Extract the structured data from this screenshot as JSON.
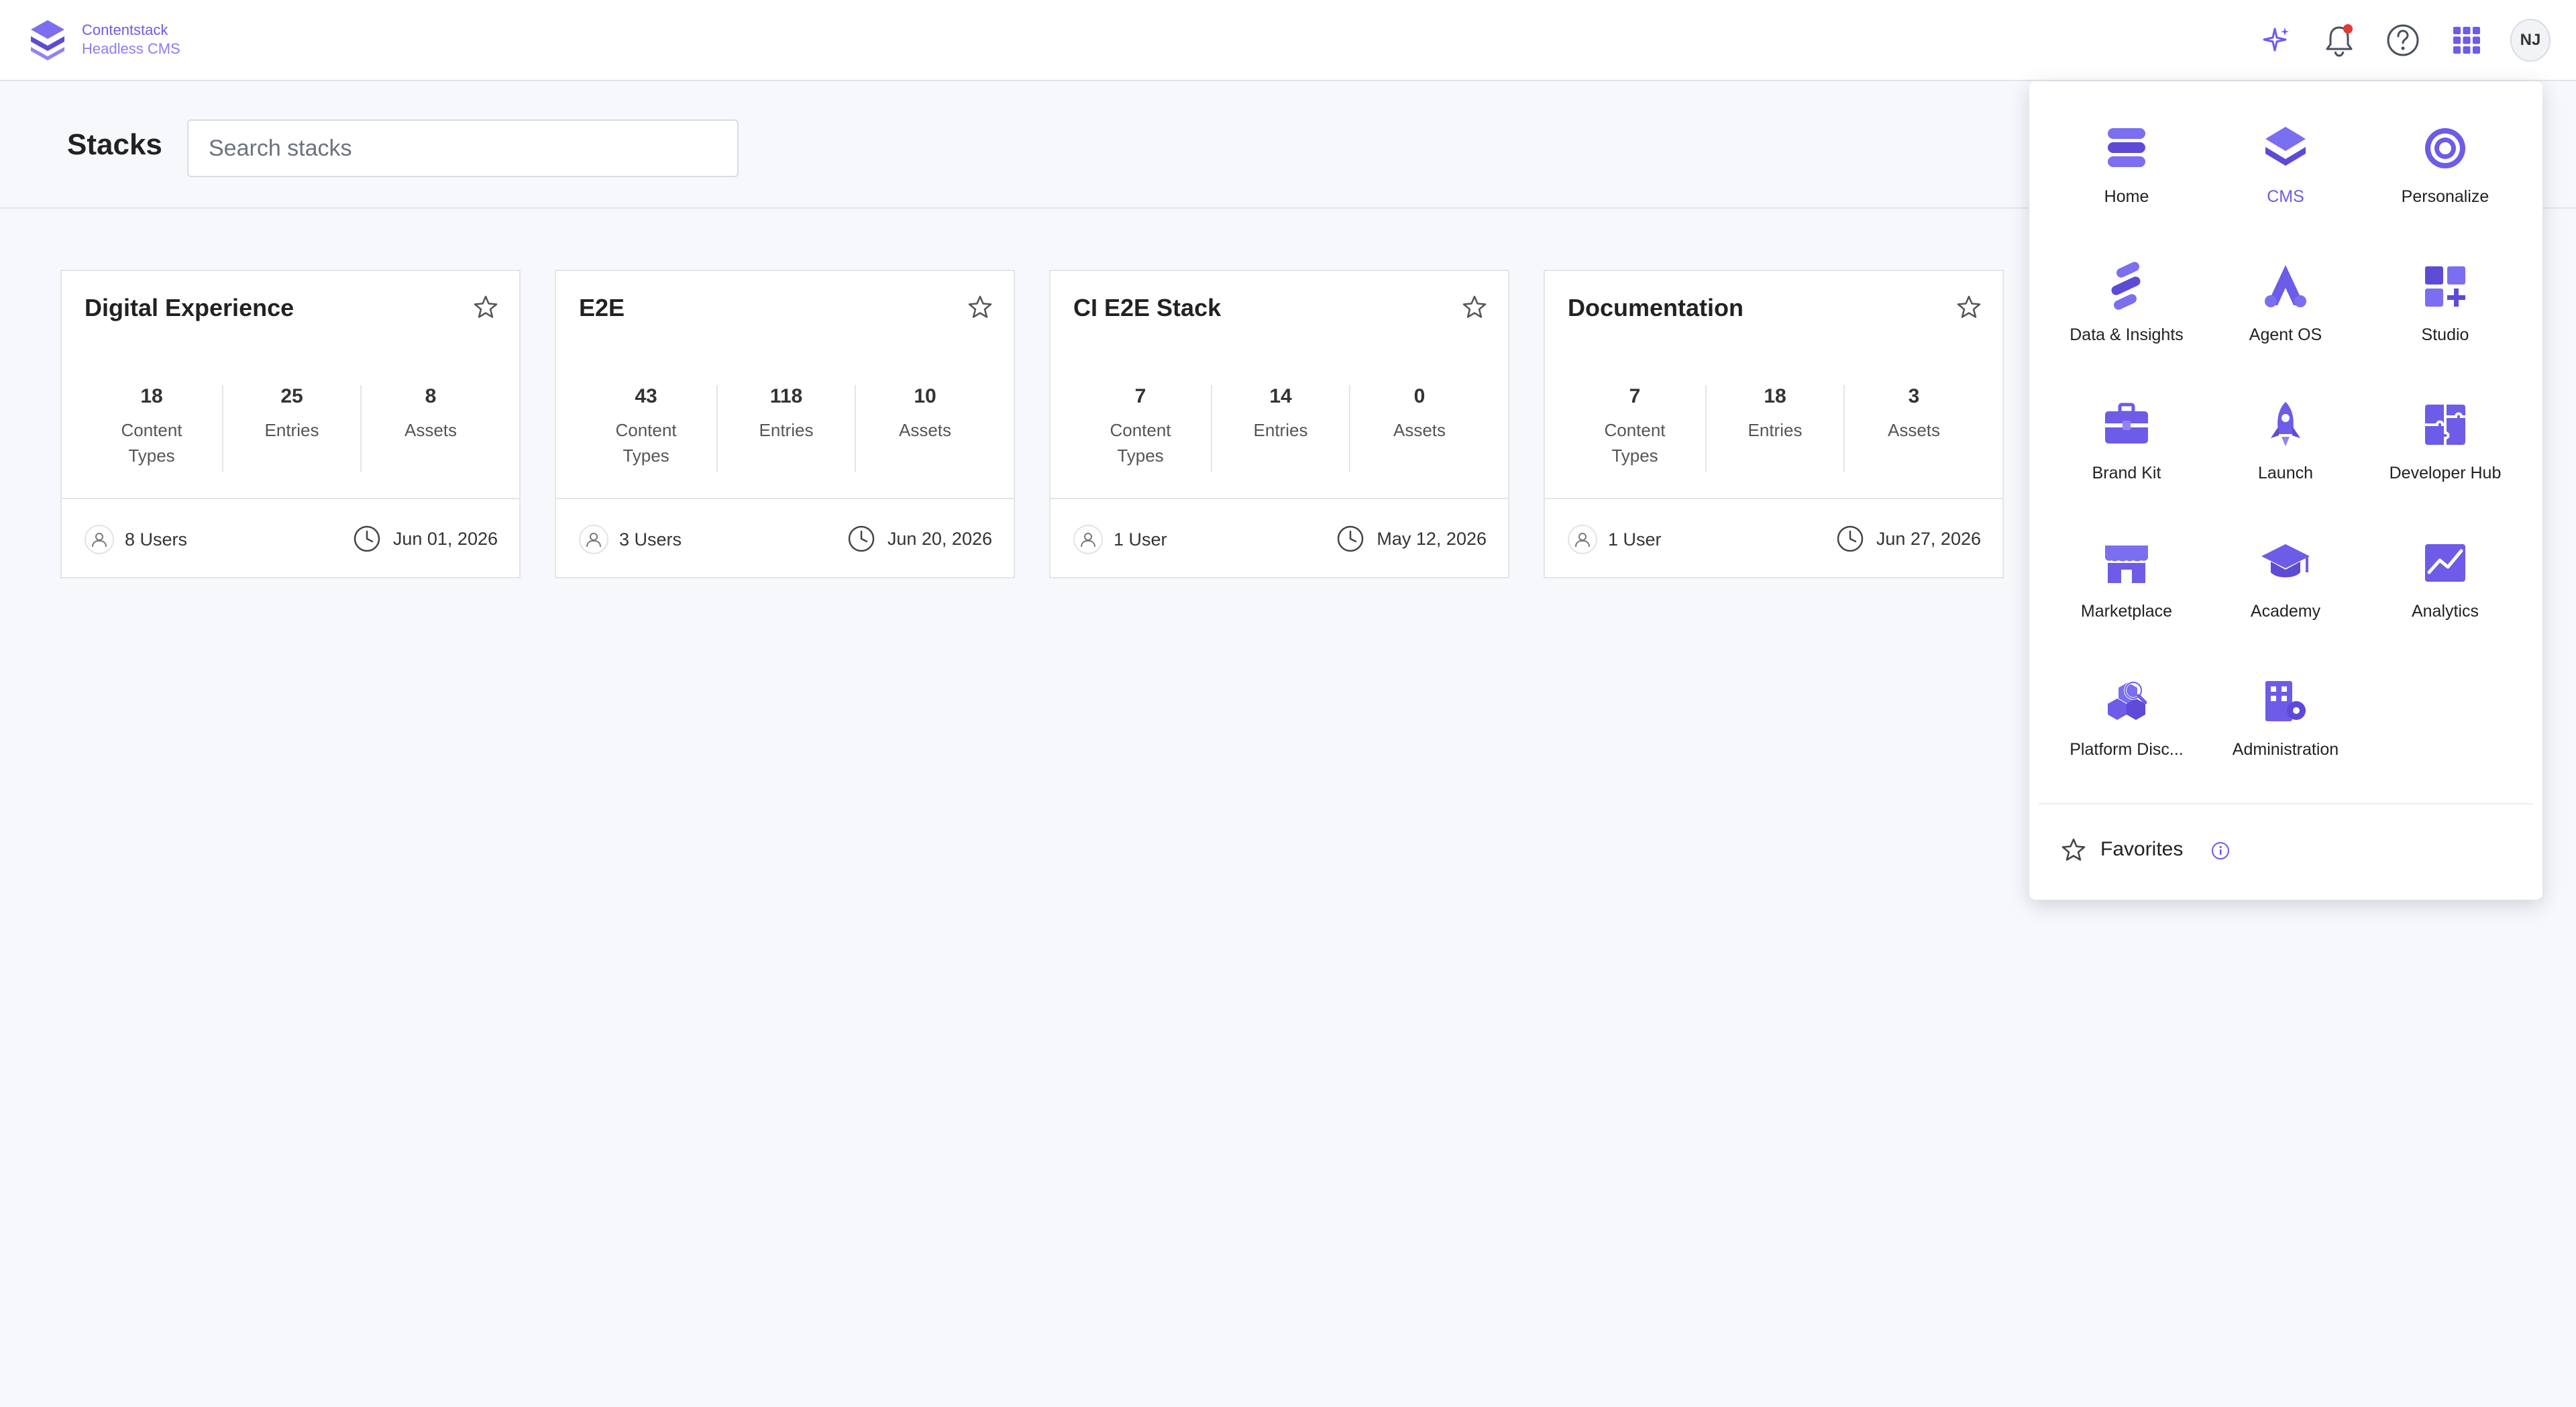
{
  "brand": {
    "name": "Contentstack",
    "subtitle": "Headless CMS",
    "accent_color": "#6c5ce7"
  },
  "topbar": {
    "icons": [
      "sparkle-ai-icon",
      "bell-icon",
      "help-icon",
      "app-grid-icon"
    ],
    "notification_dot_color": "#e53935",
    "avatar_initials": "NJ"
  },
  "page": {
    "title": "Stacks",
    "search_placeholder": "Search stacks"
  },
  "stacks": [
    {
      "name": "Digital Experience",
      "content_types": "18",
      "entries": "25",
      "assets": "8",
      "users": "8 Users",
      "date": "Jun 01, 2026"
    },
    {
      "name": "E2E",
      "content_types": "43",
      "entries": "118",
      "assets": "10",
      "users": "3 Users",
      "date": "Jun 20, 2026"
    },
    {
      "name": "CI E2E Stack",
      "content_types": "7",
      "entries": "14",
      "assets": "0",
      "users": "1 User",
      "date": "May 12, 2026"
    },
    {
      "name": "Documentation",
      "content_types": "7",
      "entries": "18",
      "assets": "3",
      "users": "1 User",
      "date": "Jun 27, 2026"
    }
  ],
  "stat_labels": {
    "content": "Content",
    "types": "Types",
    "entries": "Entries",
    "assets": "Assets"
  },
  "app_menu": {
    "apps": [
      {
        "label": "Home",
        "icon": "home-layers-icon"
      },
      {
        "label": "CMS",
        "icon": "cms-icon",
        "active": true
      },
      {
        "label": "Personalize",
        "icon": "personalize-target-icon"
      },
      {
        "label": "Data & Insights",
        "icon": "data-insights-icon"
      },
      {
        "label": "Agent OS",
        "icon": "agent-os-icon"
      },
      {
        "label": "Studio",
        "icon": "studio-icon"
      },
      {
        "label": "Brand Kit",
        "icon": "brand-kit-icon"
      },
      {
        "label": "Launch",
        "icon": "launch-rocket-icon"
      },
      {
        "label": "Developer Hub",
        "icon": "developer-hub-icon"
      },
      {
        "label": "Marketplace",
        "icon": "marketplace-store-icon"
      },
      {
        "label": "Academy",
        "icon": "academy-cap-icon"
      },
      {
        "label": "Analytics",
        "icon": "analytics-chart-icon"
      },
      {
        "label": "Platform Disc...",
        "icon": "platform-discovery-icon"
      },
      {
        "label": "Administration",
        "icon": "administration-icon"
      }
    ],
    "favorites_label": "Favorites"
  }
}
